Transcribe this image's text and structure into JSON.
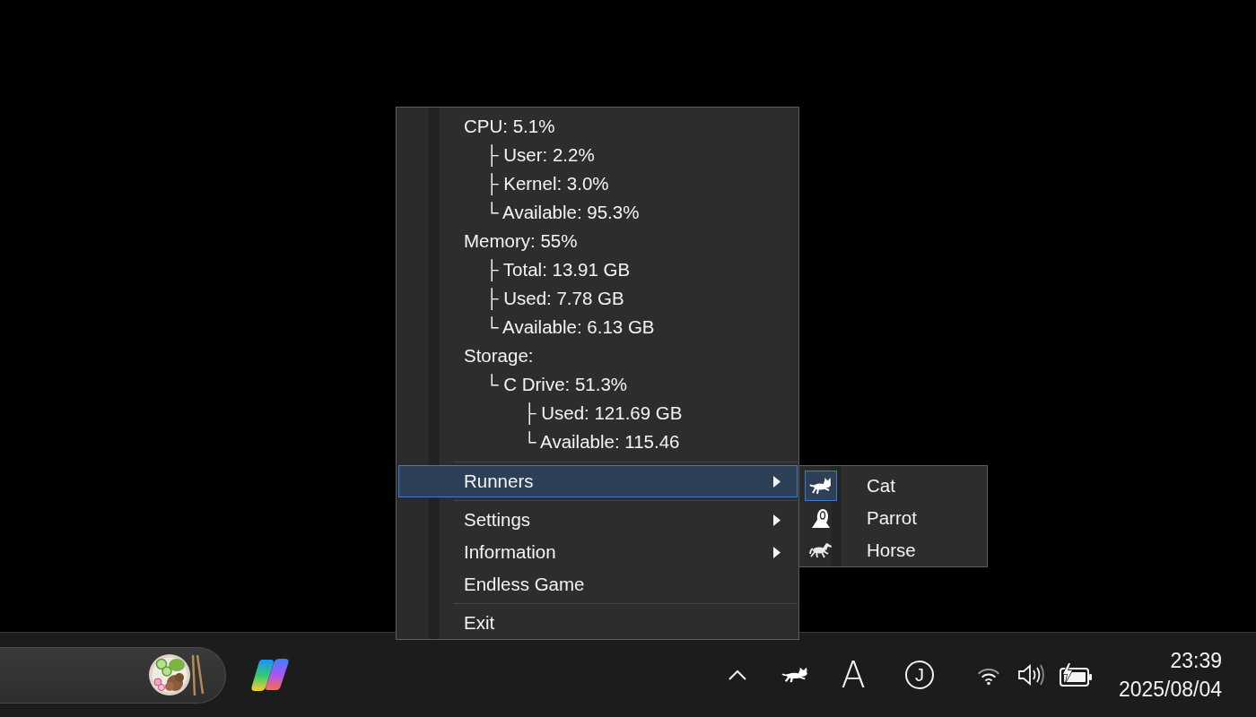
{
  "menu": {
    "stats": [
      {
        "text": "CPU: 5.1%",
        "children": [
          {
            "text": "├ User: 2.2%"
          },
          {
            "text": "├ Kernel: 3.0%"
          },
          {
            "text": "└ Available: 95.3%"
          }
        ]
      },
      {
        "text": "Memory: 55%",
        "children": [
          {
            "text": "├ Total: 13.91 GB"
          },
          {
            "text": "├ Used: 7.78 GB"
          },
          {
            "text": "└ Available: 6.13 GB"
          }
        ]
      },
      {
        "text": "Storage:",
        "children": [
          {
            "text": "└ C Drive: 51.3%",
            "children": [
              {
                "text": "├ Used: 121.69 GB"
              },
              {
                "text": "└ Available: 115.46"
              }
            ]
          }
        ]
      }
    ],
    "items": [
      {
        "kind": "separator"
      },
      {
        "kind": "submenu",
        "label": "Runners",
        "selected": true
      },
      {
        "kind": "separator"
      },
      {
        "kind": "submenu",
        "label": "Settings",
        "selected": false
      },
      {
        "kind": "submenu",
        "label": "Information",
        "selected": false
      },
      {
        "kind": "command",
        "label": "Endless Game",
        "selected": false
      },
      {
        "kind": "separator"
      },
      {
        "kind": "command",
        "label": "Exit",
        "selected": false
      }
    ]
  },
  "runners_submenu": {
    "items": [
      {
        "label": "Cat",
        "checked": true
      },
      {
        "label": "Parrot",
        "checked": false
      },
      {
        "label": "Horse",
        "checked": false
      }
    ]
  },
  "taskbar": {
    "input_mode": "A",
    "tray_badge": "J",
    "clock": {
      "time": "23:39",
      "date": "2025/08/04"
    }
  }
}
